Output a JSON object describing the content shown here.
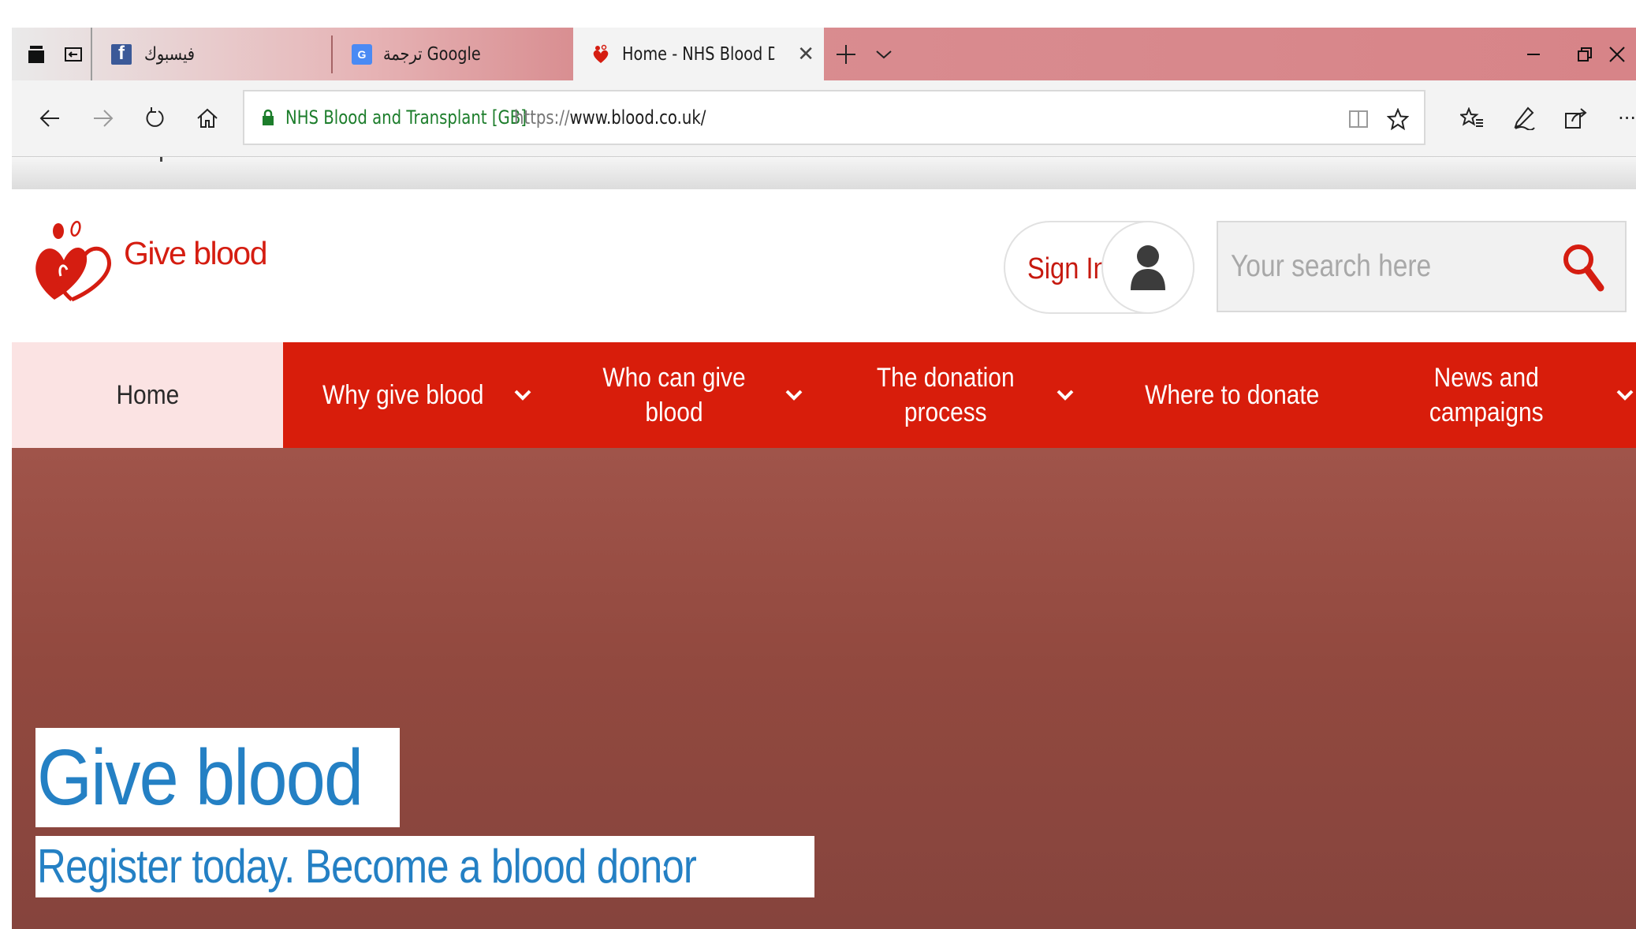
{
  "browser": {
    "tabs": [
      {
        "title": "فيسبوك",
        "favicon": "facebook-icon",
        "active": false
      },
      {
        "title": "ترجمة Google",
        "favicon": "google-translate-icon",
        "active": false
      },
      {
        "title": "Home - NHS Blood Dor",
        "favicon": "nhs-blood-icon",
        "active": true
      }
    ],
    "address": {
      "site_identity": "NHS Blood and Transplant [GB]",
      "url_protocol": "https://",
      "url_host": "www.blood.co.uk/"
    },
    "more_label": "···"
  },
  "site": {
    "logo_text": "Give blood",
    "sign_in_label": "Sign In",
    "search_placeholder": "Your search here",
    "nav": [
      {
        "label": "Home"
      },
      {
        "label": "Why give blood"
      },
      {
        "label": "Who can give\nblood"
      },
      {
        "label": "The donation\nprocess"
      },
      {
        "label": "Where to donate"
      },
      {
        "label": "News and\ncampaigns"
      }
    ],
    "hero": {
      "title": "Give blood",
      "subtitle": "Register today. Become a blood donor"
    }
  },
  "colors": {
    "brand_red": "#d81d0b",
    "logo_red": "#d51d11",
    "hero_text_blue": "#2480c4",
    "secure_green": "#1c7d2b"
  }
}
